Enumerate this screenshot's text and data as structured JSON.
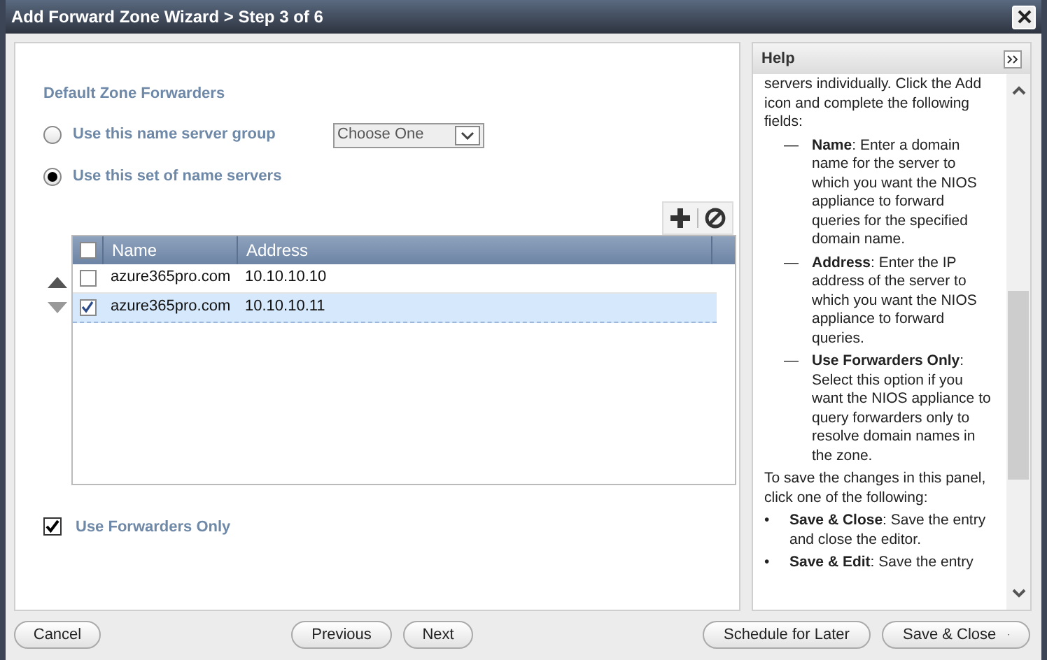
{
  "window": {
    "title": "Add Forward Zone Wizard > Step 3 of 6"
  },
  "section_title": "Default Zone Forwarders",
  "options": [
    {
      "label": "Use this name server group",
      "selected": false,
      "kind": "group"
    },
    {
      "label": "Use this set of name servers",
      "selected": true,
      "kind": "set"
    }
  ],
  "group_select": {
    "value": "Choose One"
  },
  "table": {
    "columns": [
      "Name",
      "Address"
    ],
    "header_checked": false,
    "rows": [
      {
        "name": "azure365pro.com",
        "address": "10.10.10.10",
        "checked": false,
        "selected": false
      },
      {
        "name": "azure365pro.com",
        "address": "10.10.10.11",
        "checked": true,
        "selected": true
      }
    ]
  },
  "use_forwarders_only": {
    "label": "Use Forwarders Only",
    "checked": true
  },
  "help": {
    "title": "Help",
    "items": [
      {
        "kind": "para",
        "text": "servers individually. Click the Add icon and complete the following fields:"
      },
      {
        "kind": "dash",
        "mark": "—",
        "text": "**Name**: Enter a domain name for the server to which you want the NIOS appliance to forward queries for the specified domain name."
      },
      {
        "kind": "dash",
        "mark": "—",
        "text": "**Address**: Enter the IP address of the server to which you want the NIOS appliance to forward queries."
      },
      {
        "kind": "dash",
        "mark": "—",
        "text": "**Use Forwarders Only**: Select this option if you want the NIOS appliance to query forwarders only to resolve domain names in the zone."
      },
      {
        "kind": "para",
        "text": "To save the changes in this panel, click one of the following:"
      },
      {
        "kind": "bullet",
        "mark": "•",
        "text": "**Save & Close**: Save the entry and close the editor."
      },
      {
        "kind": "bullet",
        "mark": "•",
        "text": "**Save & Edit**: Save the entry"
      }
    ]
  },
  "footer": {
    "left": [
      "Cancel"
    ],
    "center": [
      "Previous",
      "Next"
    ],
    "right": [
      "Schedule for Later"
    ],
    "save_menu": "Save & Close"
  }
}
